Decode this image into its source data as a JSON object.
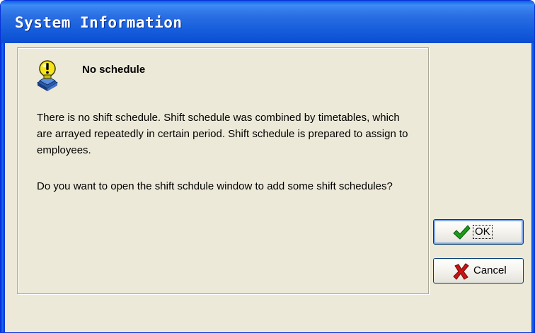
{
  "window": {
    "title": "System Information"
  },
  "message": {
    "icon": "info-lightbulb-icon",
    "heading": "No schedule",
    "paragraph1": "There is no shift schedule. Shift schedule was combined by timetables, which are arrayed repeatedly in certain period. Shift schedule is prepared to assign to employees.",
    "paragraph2": "Do you want to open the shift schdule window to add some shift schedules?"
  },
  "buttons": {
    "ok_label": "OK",
    "ok_icon": "checkmark-icon",
    "cancel_label": "Cancel",
    "cancel_icon": "cross-icon"
  },
  "colors": {
    "titlebar": "#155ddc",
    "dialog_background": "#ece9d8",
    "ok_check": "#1a9c1a",
    "cancel_cross": "#c81414"
  }
}
